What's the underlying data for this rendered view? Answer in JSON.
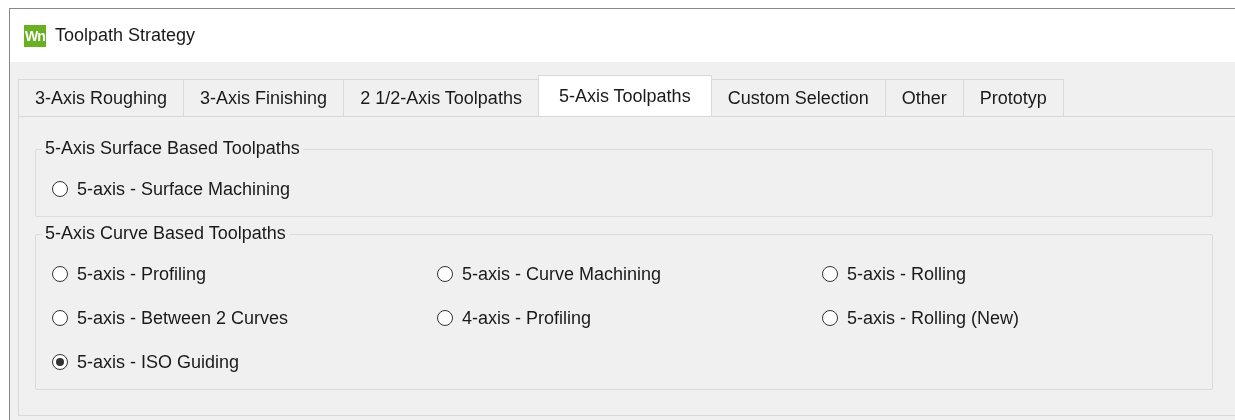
{
  "window": {
    "title": "Toolpath Strategy",
    "logo": "Wn"
  },
  "tabs": [
    {
      "label": "3-Axis Roughing",
      "selected": false
    },
    {
      "label": "3-Axis Finishing",
      "selected": false
    },
    {
      "label": "2 1/2-Axis Toolpaths",
      "selected": false
    },
    {
      "label": "5-Axis Toolpaths",
      "selected": true
    },
    {
      "label": "Custom Selection",
      "selected": false
    },
    {
      "label": "Other",
      "selected": false
    },
    {
      "label": "Prototyp",
      "selected": false
    }
  ],
  "groups": [
    {
      "title": "5-Axis Surface Based Toolpaths",
      "options": [
        {
          "label": "5-axis - Surface Machining",
          "selected": false
        }
      ]
    },
    {
      "title": "5-Axis Curve Based Toolpaths",
      "options": [
        {
          "label": "5-axis - Profiling",
          "selected": false
        },
        {
          "label": "5-axis - Curve Machining",
          "selected": false
        },
        {
          "label": "5-axis - Rolling",
          "selected": false
        },
        {
          "label": "5-axis - Between 2 Curves",
          "selected": false
        },
        {
          "label": "4-axis - Profiling",
          "selected": false
        },
        {
          "label": "5-axis - Rolling (New)",
          "selected": false
        },
        {
          "label": "5-axis - ISO Guiding",
          "selected": true
        }
      ]
    }
  ]
}
